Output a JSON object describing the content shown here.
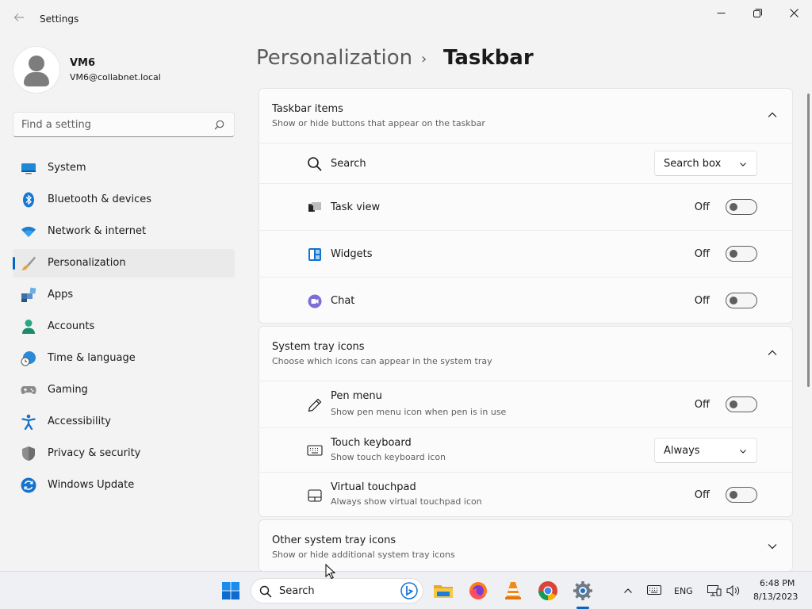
{
  "window": {
    "title": "Settings",
    "back_icon": "back-arrow-icon",
    "controls": [
      "minimize-icon",
      "maximize-icon",
      "close-icon"
    ]
  },
  "account": {
    "name": "VM6",
    "email": "VM6@collabnet.local"
  },
  "search": {
    "placeholder": "Find a setting"
  },
  "nav": {
    "items": [
      {
        "label": "System",
        "icon": "system-icon"
      },
      {
        "label": "Bluetooth & devices",
        "icon": "bluetooth-icon"
      },
      {
        "label": "Network & internet",
        "icon": "wifi-icon"
      },
      {
        "label": "Personalization",
        "icon": "brush-icon",
        "active": true
      },
      {
        "label": "Apps",
        "icon": "apps-icon"
      },
      {
        "label": "Accounts",
        "icon": "accounts-icon"
      },
      {
        "label": "Time & language",
        "icon": "clock-globe-icon"
      },
      {
        "label": "Gaming",
        "icon": "gamepad-icon"
      },
      {
        "label": "Accessibility",
        "icon": "accessibility-icon"
      },
      {
        "label": "Privacy & security",
        "icon": "shield-icon"
      },
      {
        "label": "Windows Update",
        "icon": "update-icon"
      }
    ]
  },
  "header": {
    "parent": "Personalization",
    "separator": "›",
    "current": "Taskbar"
  },
  "taskbar_items": {
    "title": "Taskbar items",
    "subtitle": "Show or hide buttons that appear on the taskbar",
    "expanded": true,
    "rows": [
      {
        "label": "Search",
        "icon": "search-icon",
        "control": "dropdown",
        "value": "Search box"
      },
      {
        "label": "Task view",
        "icon": "task-view-icon",
        "control": "toggle",
        "value": "Off"
      },
      {
        "label": "Widgets",
        "icon": "widgets-icon",
        "control": "toggle",
        "value": "Off"
      },
      {
        "label": "Chat",
        "icon": "chat-icon",
        "control": "toggle",
        "value": "Off"
      }
    ]
  },
  "system_tray": {
    "title": "System tray icons",
    "subtitle": "Choose which icons can appear in the system tray",
    "expanded": true,
    "rows": [
      {
        "label": "Pen menu",
        "desc": "Show pen menu icon when pen is in use",
        "icon": "pen-icon",
        "control": "toggle",
        "value": "Off"
      },
      {
        "label": "Touch keyboard",
        "desc": "Show touch keyboard icon",
        "icon": "keyboard-icon",
        "control": "dropdown",
        "value": "Always"
      },
      {
        "label": "Virtual touchpad",
        "desc": "Always show virtual touchpad icon",
        "icon": "touchpad-icon",
        "control": "toggle",
        "value": "Off"
      }
    ]
  },
  "other_tray": {
    "title": "Other system tray icons",
    "subtitle": "Show or hide additional system tray icons",
    "expanded": false
  },
  "taskbar": {
    "search_placeholder": "Search",
    "apps": [
      "start-icon",
      "file-explorer-icon",
      "firefox-icon",
      "vlc-icon",
      "chrome-icon",
      "settings-app-icon"
    ],
    "tray": {
      "language": "ENG",
      "time": "6:48 PM",
      "date": "8/13/2023"
    }
  },
  "colors": {
    "accent": "#0067c0",
    "background": "#f3f3f3",
    "card": "#fbfbfb"
  }
}
